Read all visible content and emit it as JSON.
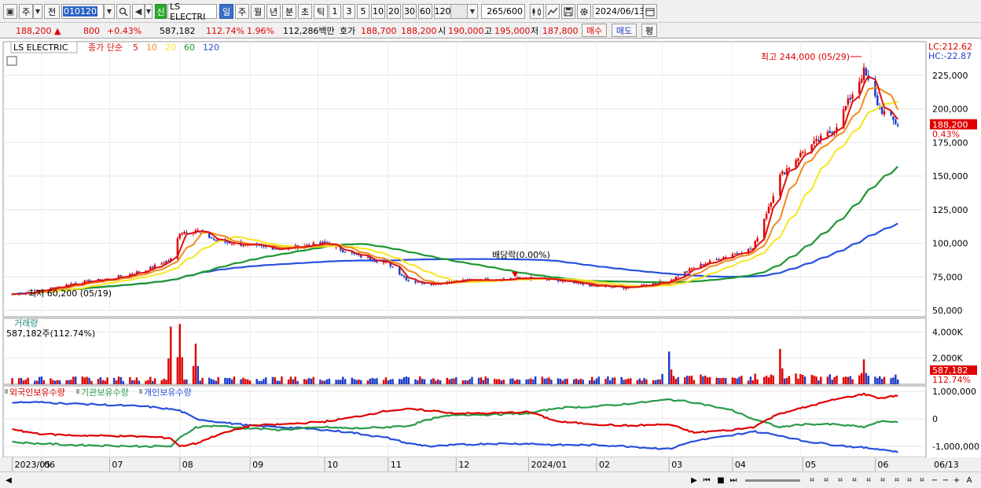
{
  "toolbar": {
    "market": "주",
    "prev": "전",
    "code": "010120",
    "name_badge": "신",
    "name": "LS ELECTRI",
    "periods": [
      "일",
      "주",
      "월",
      "년",
      "분",
      "초",
      "틱"
    ],
    "active_period": "일",
    "intervals": [
      "1",
      "3",
      "5",
      "10",
      "20",
      "30",
      "60",
      "120"
    ],
    "count": "265",
    "count_total": "/600",
    "date": "2024/06/13"
  },
  "info": {
    "price": "188,200",
    "arrow": "▲",
    "change": "800",
    "change_pct": "+0.43%",
    "volume": "587,182",
    "volume_ratio": "112.74%",
    "turnover_pct": "1.96%",
    "amount": "112,286백만",
    "quote_label": "호가",
    "ask": "188,700",
    "bid": "188,200",
    "open_label": "시",
    "open": "190,000",
    "high_label": "고",
    "high": "195,000",
    "low_label": "저",
    "low": "187,800",
    "buy": "매수",
    "sell": "매도",
    "eval": "평"
  },
  "chart_data": {
    "type": "candlestick",
    "title": "LS ELECTRIC",
    "price_panel": {
      "legend": {
        "name": "LS ELECTRIC",
        "ma_label": "종가 단순",
        "periods": [
          "5",
          "10",
          "20",
          "60",
          "120"
        ]
      },
      "colors": {
        "ma5": "#e01010",
        "ma10": "#f08c1e",
        "ma20": "#f5e61e",
        "ma60": "#1e9632",
        "ma120": "#2850dc",
        "up": "#e00000",
        "down": "#1e3cc8"
      },
      "ylim": [
        50000,
        250000
      ],
      "y_ticks": [
        "225,000",
        "200,000",
        "175,000",
        "150,000",
        "125,000",
        "100,000",
        "75,000",
        "50,000"
      ],
      "lc_label": "LC:212.62",
      "hc_label": "HC:-22.87",
      "last_price_tag": "188,200",
      "last_pct_tag": "0.43%",
      "high_annotation": "최고 244,000 (05/29)",
      "low_annotation": "최저 60,200 (05/19)",
      "dividend_annotation": "배당락(0.00%)",
      "close_series": {
        "dates": [
          "2023/05/19",
          "2023/06/01",
          "2023/06/15",
          "2023/07/03",
          "2023/07/17",
          "2023/07/28",
          "2023/08/01",
          "2023/08/08",
          "2023/08/17",
          "2023/09/01",
          "2023/09/15",
          "2023/10/04",
          "2023/10/16",
          "2023/11/01",
          "2023/11/10",
          "2023/11/20",
          "2023/12/01",
          "2023/12/15",
          "2024/01/02",
          "2024/01/15",
          "2024/02/01",
          "2024/02/15",
          "2024/03/04",
          "2024/03/15",
          "2024/04/01",
          "2024/04/10",
          "2024/04/22",
          "2024/05/02",
          "2024/05/16",
          "2024/05/29",
          "2024/06/05",
          "2024/06/13"
        ],
        "close": [
          62000,
          65000,
          70000,
          74000,
          80000,
          88000,
          108000,
          110000,
          102000,
          98000,
          96000,
          100000,
          92000,
          85000,
          72000,
          70000,
          72000,
          73000,
          74000,
          72000,
          68000,
          67000,
          72000,
          82000,
          92000,
          96000,
          150000,
          168000,
          185000,
          228000,
          200000,
          188200
        ],
        "ma60_end": 157000,
        "ma120_end": 113000
      }
    },
    "volume_panel": {
      "label": "거래량",
      "value": "587,182주(112.74%)",
      "y_ticks": [
        "4,000K",
        "2,000K",
        "0"
      ],
      "ylim": [
        0,
        4800000
      ],
      "last_tag": "587,182",
      "last_pct": "112.74%",
      "spikes": [
        {
          "date": "2023/07/28",
          "value": 4400000
        },
        {
          "date": "2023/08/01",
          "value": 4600000
        },
        {
          "date": "2023/08/08",
          "value": 3100000
        },
        {
          "date": "2024/03/04",
          "value": 2500000
        },
        {
          "date": "2024/04/22",
          "value": 2700000
        },
        {
          "date": "2024/05/29",
          "value": 1900000
        }
      ]
    },
    "holding_panel": {
      "labels": [
        "외국인보유수량",
        "기관보유수량",
        "개인보유수량"
      ],
      "colors": [
        "#e00000",
        "#2a9a4a",
        "#2850dc"
      ],
      "y_ticks": [
        "1,000,000",
        "0",
        "-1,000,000"
      ],
      "ylim": [
        -1400000,
        1200000
      ],
      "foreign": [
        -400000,
        -550000,
        -600000,
        -620000,
        -650000,
        -700000,
        -1000000,
        -900000,
        -600000,
        -250000,
        -200000,
        -100000,
        50000,
        300000,
        350000,
        300000,
        200000,
        200000,
        250000,
        -100000,
        -200000,
        -250000,
        -200000,
        -500000,
        -400000,
        -300000,
        200000,
        400000,
        700000,
        900000,
        750000,
        850000
      ],
      "institution": [
        -850000,
        -900000,
        -950000,
        -980000,
        -1000000,
        -1000000,
        -700000,
        -300000,
        -250000,
        -350000,
        -400000,
        -300000,
        -350000,
        -300000,
        -250000,
        0,
        150000,
        150000,
        200000,
        400000,
        450000,
        550000,
        700000,
        600000,
        300000,
        0,
        -300000,
        -200000,
        -200000,
        -300000,
        -100000,
        -100000
      ],
      "individual": [
        600000,
        600000,
        550000,
        500000,
        450000,
        350000,
        300000,
        0,
        -100000,
        -250000,
        -300000,
        -400000,
        -500000,
        -700000,
        -900000,
        -1000000,
        -950000,
        -900000,
        -900000,
        -950000,
        -950000,
        -1000000,
        -1100000,
        -800000,
        -600000,
        -450000,
        -600000,
        -800000,
        -950000,
        -1050000,
        -1100000,
        -1200000
      ]
    },
    "x_axis": {
      "labels": [
        "2023/05",
        "06",
        "07",
        "08",
        "09",
        "10",
        "11",
        "12",
        "2024/01",
        "02",
        "03",
        "04",
        "05",
        "06",
        "06/13"
      ]
    }
  }
}
